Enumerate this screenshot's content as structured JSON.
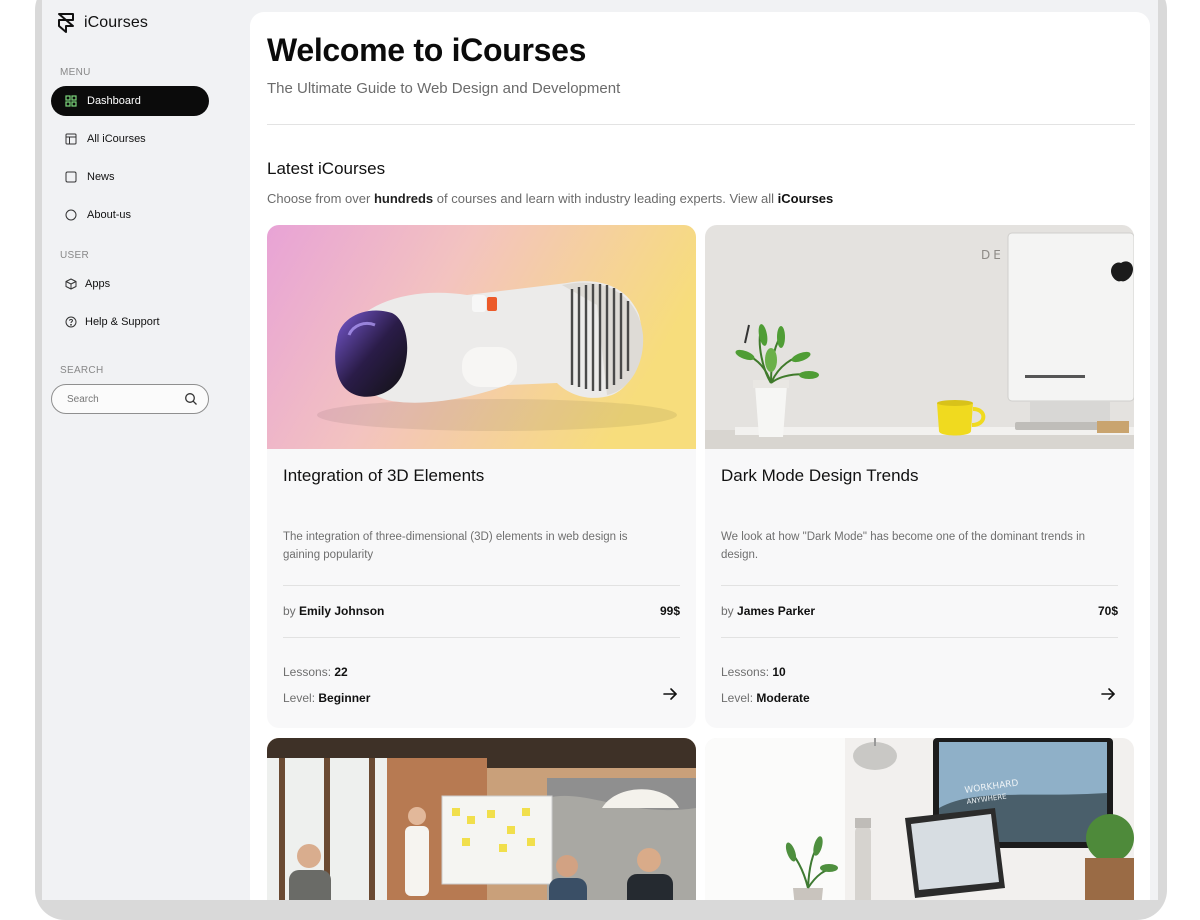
{
  "colors": {
    "accent_dark": "#0b0b0b",
    "panel_bg": "#f1f2f4",
    "card_bg": "#f8f8f9"
  },
  "brand": {
    "name": "iCourses",
    "icon": "framer-logo-icon"
  },
  "sidebar": {
    "menu_label": "MENU",
    "menu_items": [
      {
        "label": "Dashboard",
        "icon": "grid-icon",
        "active": true
      },
      {
        "label": "All iCourses",
        "icon": "layout-icon"
      },
      {
        "label": "News",
        "icon": "square-icon"
      },
      {
        "label": "About-us",
        "icon": "circle-icon"
      }
    ],
    "user_label": "USER",
    "user_items": [
      {
        "label": "Apps",
        "icon": "cube-icon"
      },
      {
        "label": "Help & Support",
        "icon": "help-circle-icon"
      }
    ],
    "search_label": "SEARCH",
    "search_placeholder": "Search"
  },
  "main": {
    "title": "Welcome to iCourses",
    "subtitle": "The Ultimate Guide to Web Design and Development",
    "section_title": "Latest iCourses",
    "section_desc": {
      "before": "Choose from over ",
      "bold": "hundreds",
      "middle": " of courses and learn with industry leading experts. View all ",
      "link": "iCourses"
    },
    "cards": [
      {
        "title": "Integration of 3D Elements",
        "description": "The integration of three-dimensional (3D) elements in web design is gaining popularity",
        "by": "by",
        "author": "Emily Johnson",
        "price": "99$",
        "lessons_label": "Lessons:",
        "lessons": "22",
        "level_label": "Level:",
        "level": "Beginner"
      },
      {
        "title": "Dark Mode Design Trends",
        "description": "We look at how \"Dark Mode\" has become one of the dominant trends in design.",
        "by": "by",
        "author": "James Parker",
        "price": "70$",
        "lessons_label": "Lessons:",
        "lessons": "10",
        "level_label": "Level:",
        "level": "Moderate"
      }
    ]
  }
}
